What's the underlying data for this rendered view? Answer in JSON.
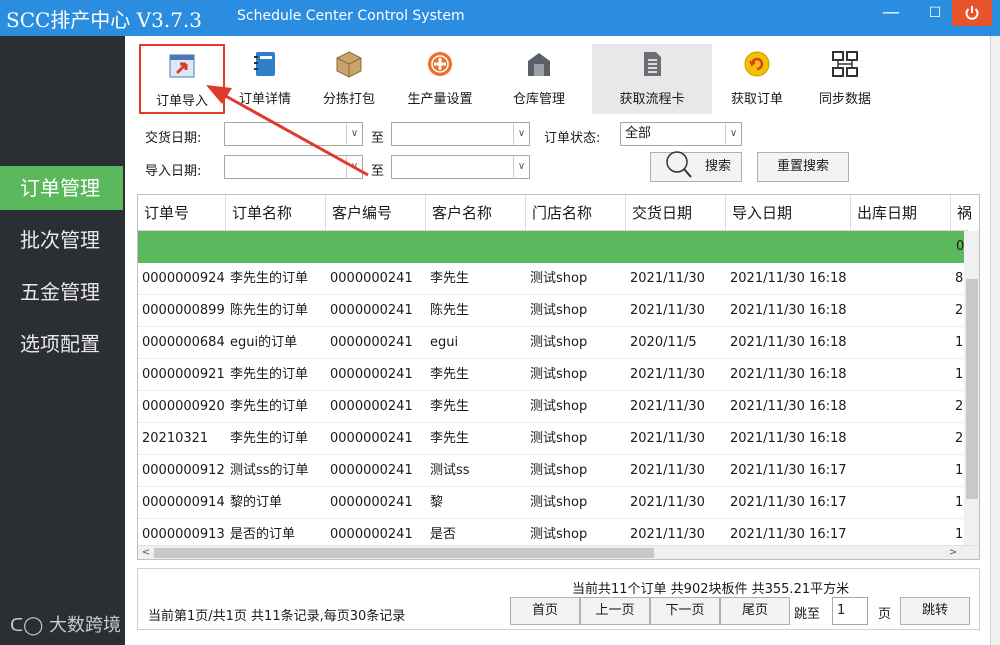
{
  "window": {
    "title": "SCC排产中心 V3.7.3",
    "subtitle": "Schedule Center Control System",
    "minimize": "—",
    "maximize": "☐",
    "close_icon": "power-icon"
  },
  "sidebar": {
    "items": [
      {
        "label": "订单管理",
        "active": true
      },
      {
        "label": "批次管理",
        "active": false
      },
      {
        "label": "五金管理",
        "active": false
      },
      {
        "label": "选项配置",
        "active": false
      }
    ],
    "watermark": "大数跨境"
  },
  "toolbar": {
    "buttons": [
      {
        "label": "订单导入",
        "icon": "import-icon"
      },
      {
        "label": "订单详情",
        "icon": "notebook-icon"
      },
      {
        "label": "分拣打包",
        "icon": "package-icon"
      },
      {
        "label": "生产量设置",
        "icon": "plus-circle-icon"
      },
      {
        "label": "仓库管理",
        "icon": "warehouse-icon"
      },
      {
        "label": "获取流程卡",
        "icon": "document-icon"
      },
      {
        "label": "获取订单",
        "icon": "refresh-icon"
      },
      {
        "label": "同步数据",
        "icon": "network-icon"
      }
    ]
  },
  "filters": {
    "delivery_date_label": "交货日期:",
    "import_date_label": "导入日期:",
    "to_label": "至",
    "status_label": "订单状态:",
    "status_value": "全部",
    "search_label": "搜索",
    "reset_label": "重置搜索"
  },
  "table": {
    "columns": [
      "订单号",
      "订单名称",
      "客户编号",
      "客户名称",
      "门店名称",
      "交货日期",
      "导入日期",
      "出库日期",
      "祸"
    ],
    "summary_value": "0",
    "rows": [
      [
        "0000000924",
        "李先生的订单",
        "0000000241",
        "李先生",
        "测试shop",
        "2021/11/30",
        "2021/11/30 16:18",
        "",
        "8"
      ],
      [
        "0000000899",
        "陈先生的订单",
        "0000000241",
        "陈先生",
        "测试shop",
        "2021/11/30",
        "2021/11/30 16:18",
        "",
        "2"
      ],
      [
        "0000000684",
        "egui的订单",
        "0000000241",
        "egui",
        "测试shop",
        "2020/11/5",
        "2021/11/30 16:18",
        "",
        "1"
      ],
      [
        "0000000921",
        "李先生的订单",
        "0000000241",
        "李先生",
        "测试shop",
        "2021/11/30",
        "2021/11/30 16:18",
        "",
        "1"
      ],
      [
        "0000000920",
        "李先生的订单",
        "0000000241",
        "李先生",
        "测试shop",
        "2021/11/30",
        "2021/11/30 16:18",
        "",
        "2"
      ],
      [
        "20210321",
        "李先生的订单",
        "0000000241",
        "李先生",
        "测试shop",
        "2021/11/30",
        "2021/11/30 16:18",
        "",
        "2"
      ],
      [
        "0000000912",
        "测试ss的订单",
        "0000000241",
        "测试ss",
        "测试shop",
        "2021/11/30",
        "2021/11/30 16:17",
        "",
        "1"
      ],
      [
        "0000000914",
        "黎的订单",
        "0000000241",
        "黎",
        "测试shop",
        "2021/11/30",
        "2021/11/30 16:17",
        "",
        "1"
      ],
      [
        "0000000913",
        "是否的订单",
        "0000000241",
        "是否",
        "测试shop",
        "2021/11/30",
        "2021/11/30 16:17",
        "",
        "1"
      ]
    ]
  },
  "footer": {
    "summary": "当前共11个订单  共902块板件  共355.21平方米",
    "page_info": "当前第1页/共1页  共11条记录,每页30条记录",
    "first": "首页",
    "prev": "上一页",
    "next": "下一页",
    "last": "尾页",
    "goto": "跳至",
    "page_value": "1",
    "page_unit": "页",
    "jump": "跳转"
  }
}
